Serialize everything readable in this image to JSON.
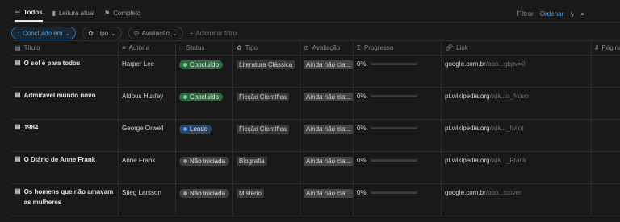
{
  "tabs": [
    {
      "label": "Todos",
      "icon": "stack-icon",
      "active": true
    },
    {
      "label": "Leitura atual",
      "icon": "book-icon",
      "active": false
    },
    {
      "label": "Completo",
      "icon": "flag-icon",
      "active": false
    }
  ],
  "toolbar": {
    "filter": "Filtrar",
    "sort": "Ordenar",
    "bolt_icon": "bolt-icon",
    "search_icon": "search-icon"
  },
  "filters": [
    {
      "label": "Concluído em",
      "blue": true
    },
    {
      "label": "Tipo",
      "blue": false
    },
    {
      "label": "Avaliação",
      "blue": false
    }
  ],
  "add_filter": "Adicionar filtro",
  "columns": [
    "Título",
    "Autoria",
    "Status",
    "Tipo",
    "Avaliação",
    "Progresso",
    "Link",
    "Página"
  ],
  "status_colors": {
    "Concluído": "#2d6b3f",
    "Lendo": "#28456c",
    "Não iniciada": "#3f3f3f"
  },
  "status_dot_colors": {
    "Concluído": "#6fcf8f",
    "Lendo": "#5aa2f0",
    "Não iniciada": "#9b9b9b"
  },
  "rows": [
    {
      "title": "O sol é para todos",
      "author": "Harper Lee",
      "status": "Concluído",
      "type": "Literatura Clássica",
      "rating": "Ainda não cla...",
      "progress": "0%",
      "progress_value": 0,
      "link_domain": "google.com.br",
      "link_path": "/boo...gbpv=0"
    },
    {
      "title": "Admirável mundo novo",
      "author": "Aldous Huxley",
      "status": "Concluído",
      "type": "Ficção Científica",
      "rating": "Ainda não cla...",
      "progress": "0%",
      "progress_value": 0,
      "link_domain": "pt.wikipedia.org",
      "link_path": "/wik...o_Novo"
    },
    {
      "title": "1984",
      "author": "George Orwell",
      "status": "Lendo",
      "type": "Ficção Científica",
      "rating": "Ainda não cla...",
      "progress": "0%",
      "progress_value": 0,
      "link_domain": "pt.wikipedia.org",
      "link_path": "/wik..._livro)"
    },
    {
      "title": "O Diário de Anne Frank",
      "author": "Anne Frank",
      "status": "Não iniciada",
      "type": "Biografia",
      "rating": "Ainda não cla...",
      "progress": "0%",
      "progress_value": 0,
      "link_domain": "pt.wikipedia.org",
      "link_path": "/wik..._Frank"
    },
    {
      "title": "Os homens que não amavam as mulheres",
      "author": "Stieg Larsson",
      "status": "Não iniciada",
      "type": "Mistério",
      "rating": "Ainda não cla...",
      "progress": "0%",
      "progress_value": 0,
      "link_domain": "google.com.br",
      "link_path": "/boo...tcover"
    }
  ]
}
